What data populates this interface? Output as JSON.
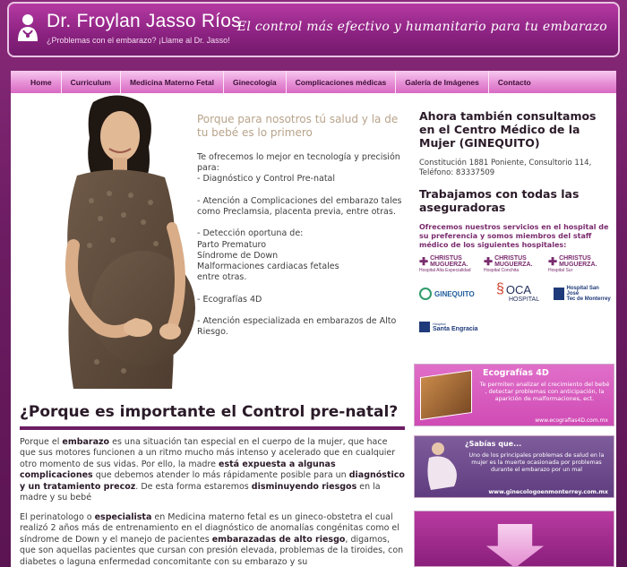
{
  "header": {
    "title": "Dr. Froylan Jasso Ríos",
    "subtitle": "¿Problemas con el embarazo? ¡Llame al Dr. Jasso!",
    "slogan": "El control más efectivo y humanitario para tu embarazo"
  },
  "nav": {
    "items": [
      "Home",
      "Curriculum",
      "Medicina Materno Fetal",
      "Ginecología",
      "Complicaciones médicas",
      "Galería de Imágenes",
      "Contacto"
    ]
  },
  "intro": {
    "headline": "Porque para nosotros tú salud y la de tu bebé es lo primero",
    "body": "Te ofrecemos lo mejor en tecnología y precisión para:\n- Diagnóstico y Control Pre-natal\n\n- Atención a Complicaciones del embarazo tales como Preclamsia, placenta previa, entre otras.\n\n- Detección oportuna de:\nParto Prematuro\nSíndrome de Down\nMalformaciones cardiacas fetales\nentre otras.\n\n- Ecografías 4D\n\n- Atención especializada en embarazos de Alto Riesgo."
  },
  "section": {
    "title": "¿Porque es importante el Control pre-natal?",
    "p1": [
      {
        "t": "Porque el "
      },
      {
        "b": "embarazo"
      },
      {
        "t": " es una situación tan especial en el cuerpo de la mujer, que hace que sus motores funcionen a un ritmo mucho más intenso y acelerado que en cualquier otro momento de sus vidas. Por ello, la madre "
      },
      {
        "b": "está expuesta a algunas complicaciones"
      },
      {
        "t": " que debemos atender lo más rápidamente posible para un "
      },
      {
        "b": "diagnóstico y un tratamiento precoz"
      },
      {
        "t": ". De esta forma estaremos "
      },
      {
        "b": "disminuyendo riesgos"
      },
      {
        "t": " en la madre y su bebé"
      }
    ],
    "p2": [
      {
        "t": "El perinatologo o "
      },
      {
        "b": "especialista"
      },
      {
        "t": " en Medicina materno fetal es un gineco-obstetra el cual realizó 2 años más de entrenamiento en el diagnóstico de anomalías congénitas como el síndrome de Down y el manejo de pacientes "
      },
      {
        "b": "embarazadas de alto riesgo"
      },
      {
        "t": ", digamos, que son aquellas pacientes que cursan con presión elevada, problemas de la tiroides, con diabetes o laguna enfermedad concomitante con su embarazo y su"
      }
    ]
  },
  "right": {
    "heading1": "Ahora también consultamos en el Centro Médico de la Mujer (GINEQUITO)",
    "address": "Constitución 1881 Poniente, Consultorio 114,\nTeléfono: 83337509",
    "heading2": "Trabajamos con todas las aseguradoras",
    "services": "Ofrecemos nuestros servicios en el hospital de su preferencia y somos miembros del staff médico de los siguientes hospitales:",
    "hospitals": [
      {
        "name": "CHRISTUS MUGUERZA.",
        "sub": "Hospital Alta Especialidad"
      },
      {
        "name": "CHRISTUS MUGUERZA.",
        "sub": "Hospital Conchita"
      },
      {
        "name": "CHRISTUS MUGUERZA.",
        "sub": "Hospital Sur"
      },
      {
        "name": "GINEQUITO",
        "sub": ""
      },
      {
        "name": "OCA",
        "sub": "HOSPITAL"
      },
      {
        "name": "Hospital San José",
        "sub": "Tec de Monterrey"
      },
      {
        "name": "Santa Engracia",
        "sub": "Hospital"
      }
    ]
  },
  "banners": {
    "b1": {
      "title": "Ecografías 4D",
      "text": "Te permiten analizar el crecimiento del bebé , detectar problemas con anticipación, la aparición de malformaciones, ect.",
      "url": "www.ecografias4D.com.mx"
    },
    "b2": {
      "title": "¿Sabías que...",
      "text": "Uno de los principales problemas de salud en la mujer es la muerte ocasionada por problemas durante el embarazo por un mal",
      "url": "www.ginecologoenmonterrey.com.mx"
    }
  },
  "colors": {
    "brand_purple": "#8a2180",
    "nav_pink": "#e78fd6",
    "headline_tan": "#b8a38a"
  }
}
